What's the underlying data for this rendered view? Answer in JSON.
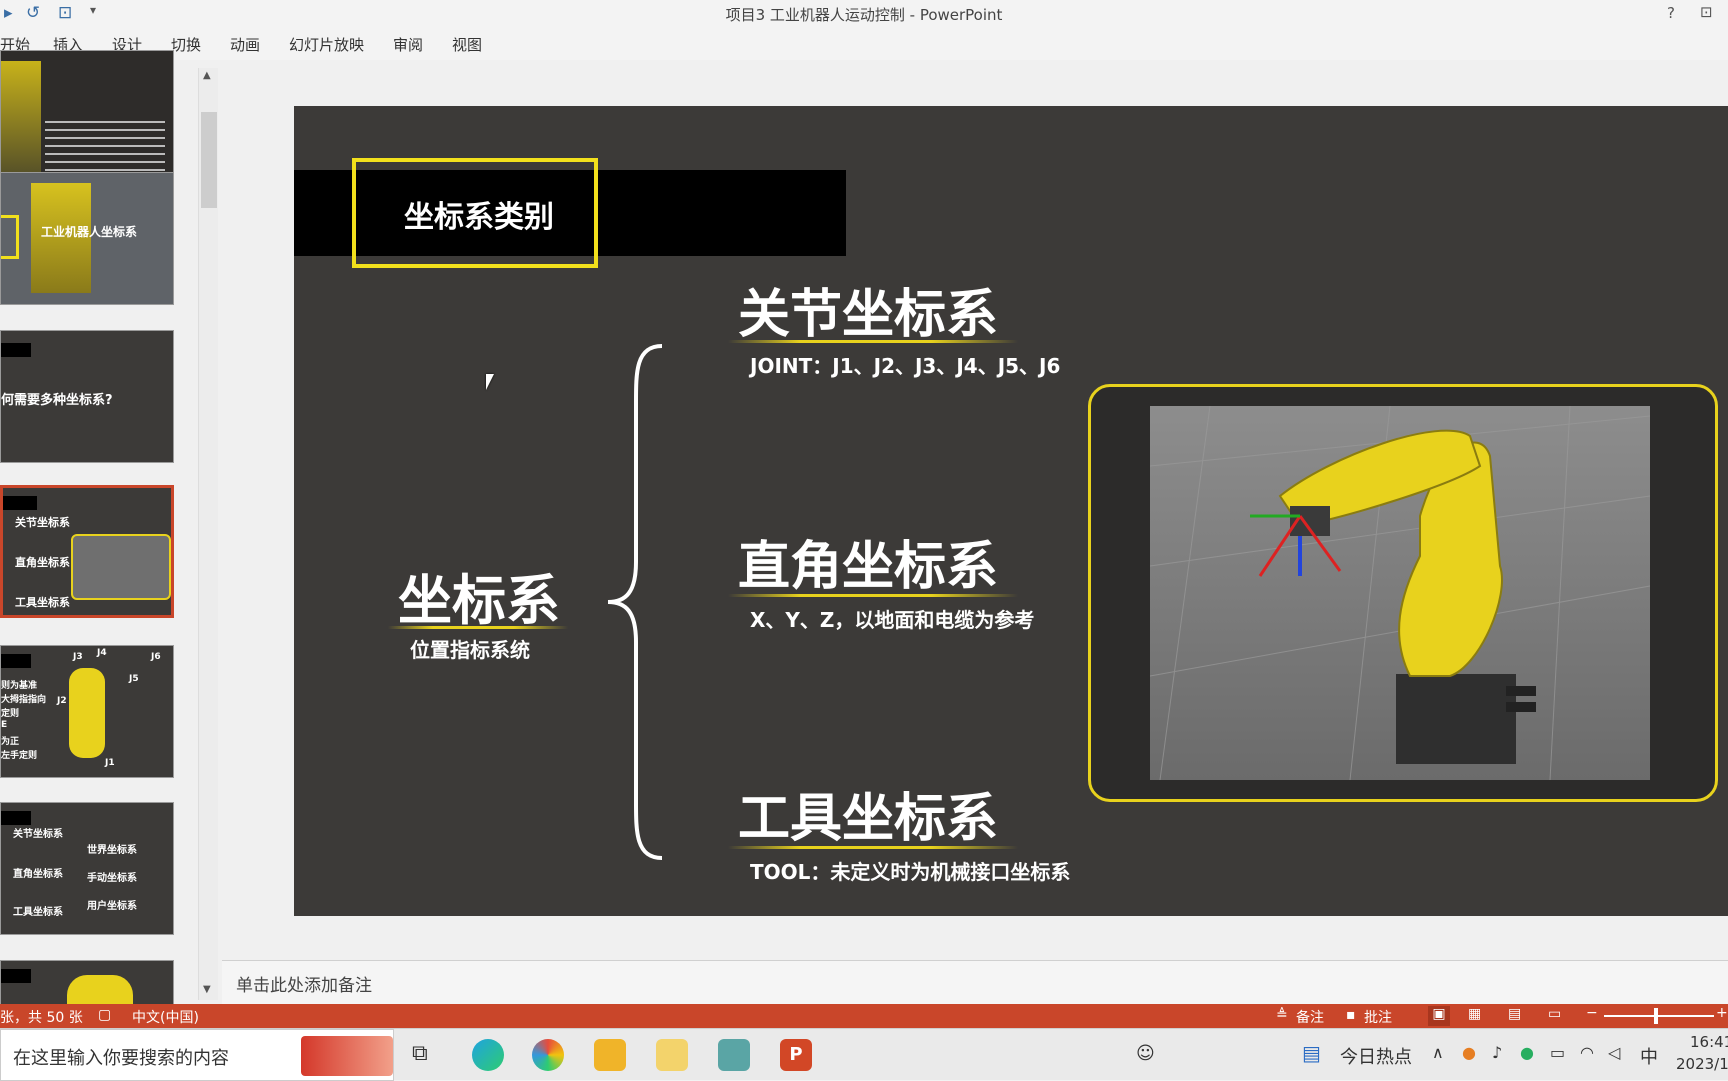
{
  "window": {
    "title": "项目3 工业机器人运动控制 - PowerPoint",
    "help": "?",
    "restore": "⊡"
  },
  "quick_access": {
    "redo": "↺",
    "present": "⊡",
    "more": "▾"
  },
  "ribbon_tabs": [
    "开始",
    "插入",
    "设计",
    "切换",
    "动画",
    "幻灯片放映",
    "审阅",
    "视图"
  ],
  "thumbnails": {
    "t2_title": "工业机器人坐标系",
    "t3_title": "何需要多种坐标系?",
    "t4_items": [
      "关节坐标系",
      "直角坐标系",
      "工具坐标系"
    ],
    "t5_labels": [
      "J3",
      "J4",
      "J5",
      "J6",
      "J2",
      "J1"
    ],
    "t5_items": [
      "则为基准",
      "大拇指指向",
      "定则",
      "E",
      "为正",
      "左手定则"
    ],
    "t6_left": [
      "关节坐标系",
      "直角坐标系",
      "工具坐标系"
    ],
    "t6_right": [
      "世界坐标系",
      "手动坐标系",
      "用户坐标系"
    ]
  },
  "slide": {
    "header": "坐标系类别",
    "main_label": "坐标系",
    "main_sub": "位置指标系统",
    "items": [
      {
        "title": "关节坐标系",
        "desc": "JOINT：J1、J2、J3、J4、J5、J6"
      },
      {
        "title": "直角坐标系",
        "desc": "X、Y、Z，以地面和电缆为参考"
      },
      {
        "title": "工具坐标系",
        "desc": "TOOL：未定义时为机械接口坐标系"
      }
    ]
  },
  "notes": {
    "placeholder": "单击此处添加备注"
  },
  "status": {
    "slide_count": "张，共 50 张",
    "language": "中文(中国)",
    "notes_btn": "备注",
    "comments_btn": "批注"
  },
  "taskbar": {
    "search_placeholder": "在这里输入你要搜索的内容",
    "news": "今日热点",
    "ime": "中",
    "time": "16:41",
    "date": "2023/1"
  },
  "colors": {
    "accent": "#c9462a",
    "highlight": "#e8d21d",
    "slide_bg": "#3c3a38"
  }
}
